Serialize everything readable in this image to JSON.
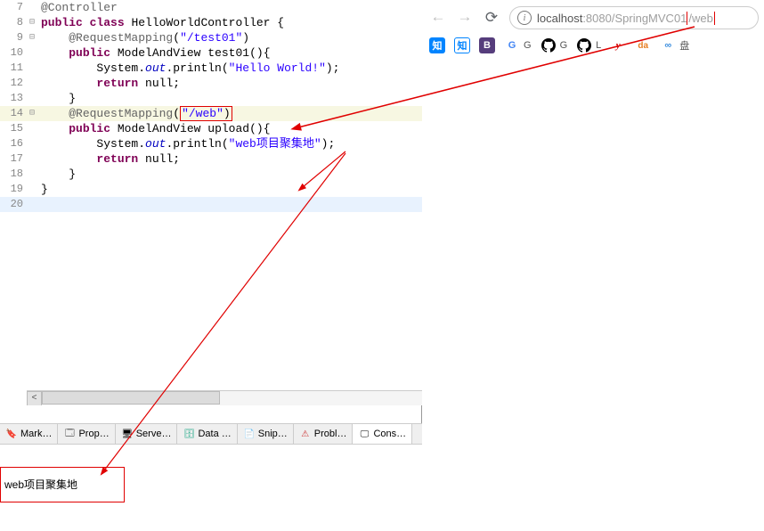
{
  "code": {
    "line7": {
      "num": "7",
      "anno": "@Controller"
    },
    "line8": {
      "num": "8",
      "kw1": "public",
      "kw2": "class",
      "cls": "HelloWorldController",
      "open": " {"
    },
    "line9": {
      "num": "9",
      "anno": "@RequestMapping",
      "str": "\"/test01\""
    },
    "line10": {
      "num": "10",
      "kw1": "public",
      "ret": "ModelAndView",
      "meth": "test01"
    },
    "line11": {
      "num": "11",
      "obj": "System.",
      "fld": "out",
      "call": ".println(",
      "str": "\"Hello World!\"",
      "end": ");"
    },
    "line12": {
      "num": "12",
      "kw": "return",
      "val": " null;"
    },
    "line13": {
      "num": "13"
    },
    "line14": {
      "num": "14",
      "anno": "@RequestMapping",
      "str": "\"/web\""
    },
    "line15": {
      "num": "15",
      "kw1": "public",
      "ret": "ModelAndView",
      "meth": "upload"
    },
    "line16": {
      "num": "16",
      "obj": "System.",
      "fld": "out",
      "call": ".println(",
      "str": "\"web项目聚集地\"",
      "end": ");"
    },
    "line17": {
      "num": "17",
      "kw": "return",
      "val": " null;"
    },
    "line18": {
      "num": "18"
    },
    "line19": {
      "num": "19"
    },
    "line20": {
      "num": "20"
    }
  },
  "tabs": {
    "t0": "Mark…",
    "t1": "Prop…",
    "t2": "Serve…",
    "t3": "Data …",
    "t4": "Snip…",
    "t5": "Probl…",
    "t6": "Cons…"
  },
  "console": {
    "output": "web项目聚集地"
  },
  "browser": {
    "host": "localhost",
    "port": ":8080",
    "path_before": "/SpringMVC01",
    "path_box": "/web"
  },
  "bookmarks": {
    "b0": "知",
    "b1": "知",
    "b2": "B",
    "b3": "G",
    "b4": "G",
    "b5": "G",
    "b6": "L",
    "b7": "y",
    "b8": "da",
    "b9": "盘"
  }
}
